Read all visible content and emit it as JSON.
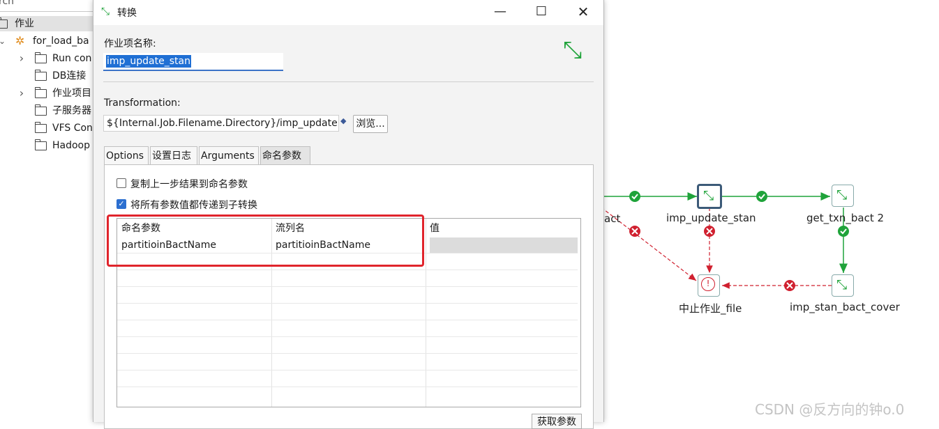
{
  "tree": {
    "search_text": "rch",
    "items": [
      {
        "label": "作业",
        "expander": ""
      },
      {
        "label": "for_load_ba",
        "expander": "⌄"
      },
      {
        "label": "Run con",
        "expander": "›"
      },
      {
        "label": "DB连接",
        "expander": ""
      },
      {
        "label": "作业项目",
        "expander": "›"
      },
      {
        "label": "子服务器",
        "expander": ""
      },
      {
        "label": "VFS Con",
        "expander": ""
      },
      {
        "label": "Hadoop",
        "expander": ""
      }
    ]
  },
  "dialog": {
    "title": "转换",
    "job_name_label": "作业项名称:",
    "job_name_value": "imp_update_stan",
    "transformation_label": "Transformation:",
    "transformation_path": "${Internal.Job.Filename.Directory}/imp_update",
    "browse_label": "浏览...",
    "tabs": [
      "Options",
      "设置日志",
      "Arguments",
      "命名参数"
    ],
    "active_tab": "命名参数",
    "copy_results_label": "复制上一步结果到命名参数",
    "copy_results_checked": false,
    "pass_all_label": "将所有参数值都传递到子转换",
    "pass_all_checked": true,
    "table": {
      "columns": [
        "命名参数",
        "流列名",
        "值"
      ],
      "rows": [
        [
          "partitioinBactName",
          "partitioinBactName",
          ""
        ]
      ]
    },
    "get_params_label": "获取参数"
  },
  "canvas": {
    "nodes": {
      "left_partial": "act",
      "imp_update_stan": "imp_update_stan",
      "get_txn_bact": "get_txn_bact 2",
      "abort": "中止作业_file",
      "cover": "imp_stan_bact_cover"
    }
  },
  "watermark": "CSDN @反方向的钟o.0",
  "colors": {
    "success_hop": "#1fa33a",
    "error_hop": "#d0202f",
    "highlight_box": "#e0242c",
    "selection": "#1f6fd4"
  }
}
